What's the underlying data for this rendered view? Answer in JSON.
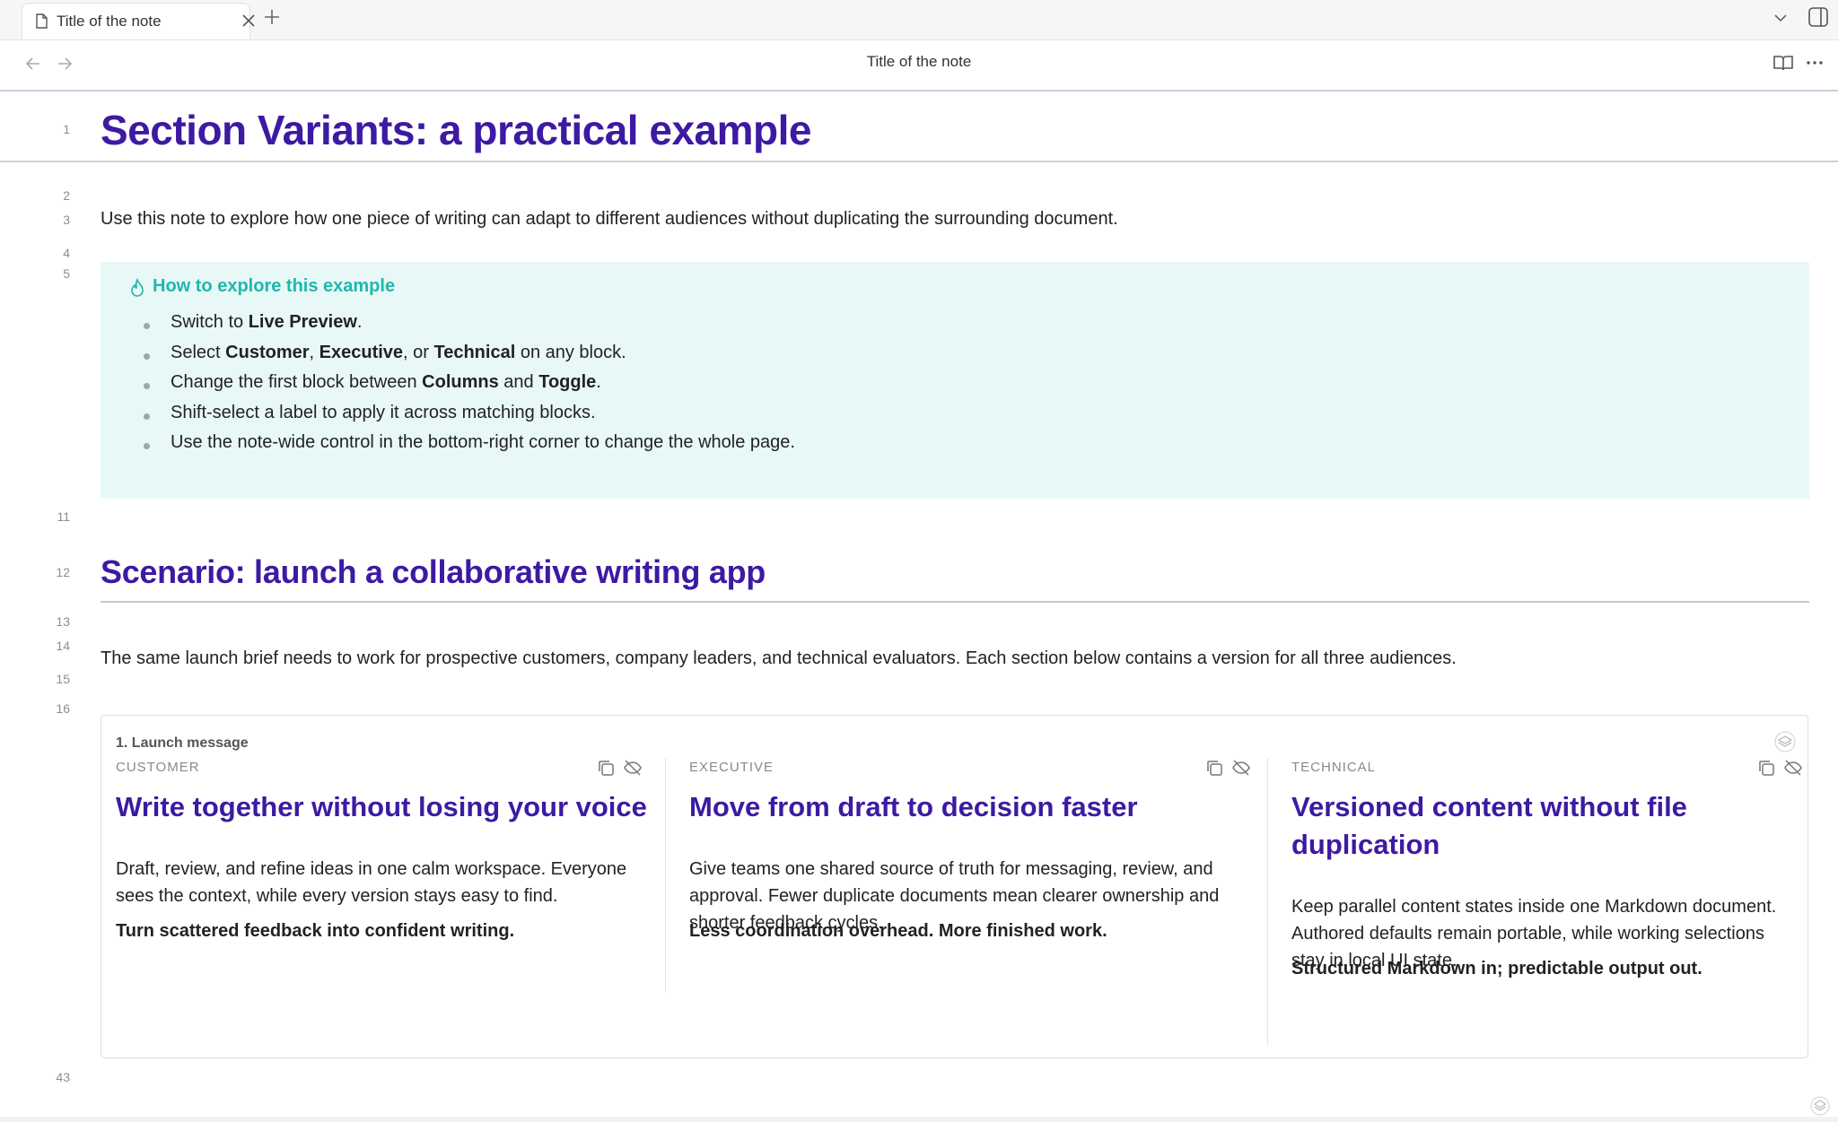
{
  "tabs": [
    {
      "label": "Title of the note"
    }
  ],
  "nav": {
    "title": "Title of the note"
  },
  "editor": {
    "line_numbers": [
      "1",
      "2",
      "3",
      "4",
      "5",
      "11",
      "12",
      "13",
      "14",
      "15",
      "16",
      "43"
    ],
    "h1": "Section Variants: a practical example",
    "intro": "Use this note to explore how one piece of writing can adapt to different audiences without duplicating the surrounding document.",
    "callout": {
      "title": "How to explore this example",
      "items": [
        {
          "parts": [
            {
              "t": "Switch to ",
              "b": false
            },
            {
              "t": "Live Preview",
              "b": true
            },
            {
              "t": ".",
              "b": false
            }
          ]
        },
        {
          "parts": [
            {
              "t": "Select ",
              "b": false
            },
            {
              "t": "Customer",
              "b": true
            },
            {
              "t": ", ",
              "b": false
            },
            {
              "t": "Executive",
              "b": true
            },
            {
              "t": ", or ",
              "b": false
            },
            {
              "t": "Technical",
              "b": true
            },
            {
              "t": " on any block.",
              "b": false
            }
          ]
        },
        {
          "parts": [
            {
              "t": "Change the first block between ",
              "b": false
            },
            {
              "t": "Columns",
              "b": true
            },
            {
              "t": " and ",
              "b": false
            },
            {
              "t": "Toggle",
              "b": true
            },
            {
              "t": ".",
              "b": false
            }
          ]
        },
        {
          "parts": [
            {
              "t": "Shift-select a label to apply it across matching blocks.",
              "b": false
            }
          ]
        },
        {
          "parts": [
            {
              "t": "Use the note-wide control in the bottom-right corner to change the whole page.",
              "b": false
            }
          ]
        }
      ]
    },
    "h2": "Scenario: launch a collaborative writing app",
    "scenario_text": "The same launch brief needs to work for prospective customers, company leaders, and technical evaluators. Each section below contains a version for all three audiences.",
    "block": {
      "label": "1. Launch message",
      "variants": [
        {
          "audience": "CUSTOMER",
          "title": "Write together without losing your voice",
          "body": "Draft, review, and refine ideas in one calm workspace. Everyone sees the context, while every version stays easy to find.",
          "tagline": "Turn scattered feedback into confident writing."
        },
        {
          "audience": "EXECUTIVE",
          "title": "Move from draft to decision faster",
          "body": "Give teams one shared source of truth for messaging, review, and approval. Fewer duplicate documents mean clearer ownership and shorter feedback cycles.",
          "tagline": "Less coordination overhead. More finished work."
        },
        {
          "audience": "TECHNICAL",
          "title": "Versioned content without file duplication",
          "body": "Keep parallel content states inside one Markdown document. Authored defaults remain portable, while working selections stay in local UI state.",
          "tagline": "Structured Markdown in; predictable output out."
        }
      ]
    }
  },
  "colors": {
    "heading": "#3d1aa3",
    "callout_bg": "#e8f8f6",
    "callout_title": "#1fb8ac"
  }
}
